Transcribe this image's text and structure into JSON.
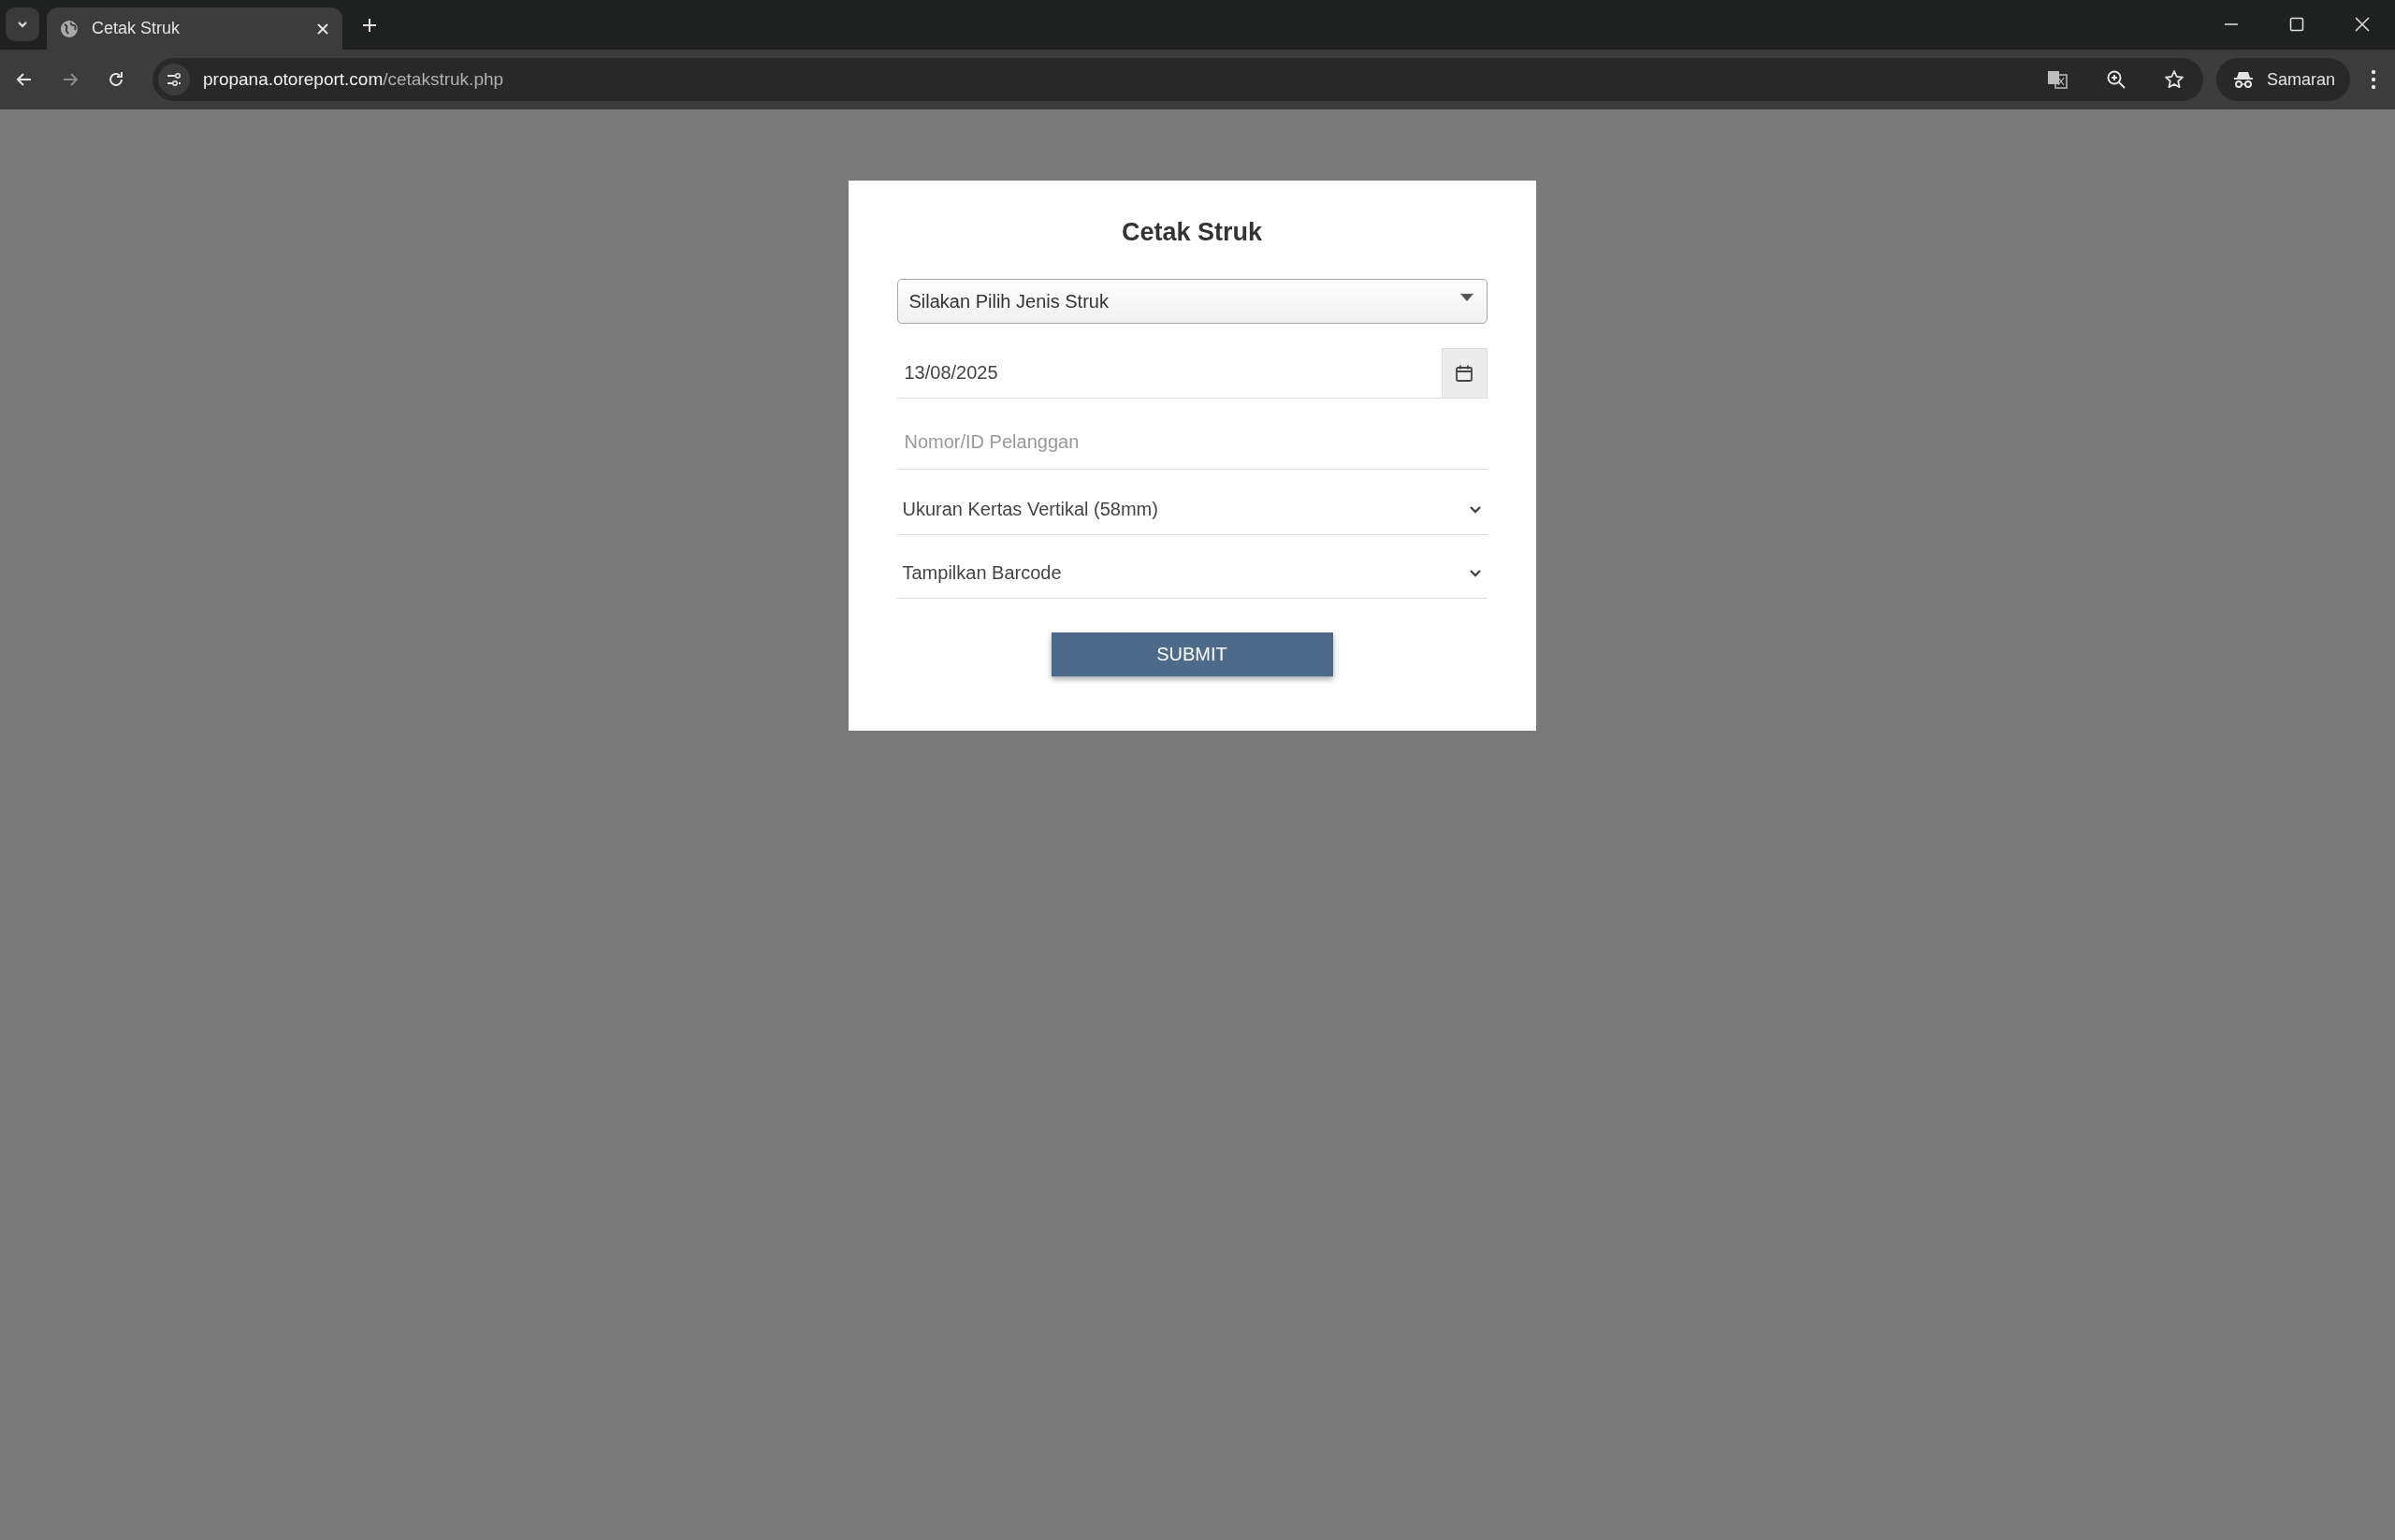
{
  "browser": {
    "tab": {
      "title": "Cetak Struk",
      "selected": true
    },
    "url": {
      "host": "propana.otoreport.com",
      "path": "/cetakstruk.php"
    },
    "profile": {
      "label": "Samaran"
    }
  },
  "form": {
    "title": "Cetak Struk",
    "fields": [
      {
        "kind": "dropdown",
        "value": "Silakan Pilih Jenis Struk"
      },
      {
        "kind": "date",
        "value": "13/08/2025"
      },
      {
        "kind": "text",
        "placeholder": "Nomor/ID Pelanggan"
      },
      {
        "kind": "select",
        "value": "Ukuran Kertas Vertikal (58mm)"
      },
      {
        "kind": "select",
        "value": "Tampilkan Barcode"
      }
    ],
    "submit": "SUBMIT"
  }
}
